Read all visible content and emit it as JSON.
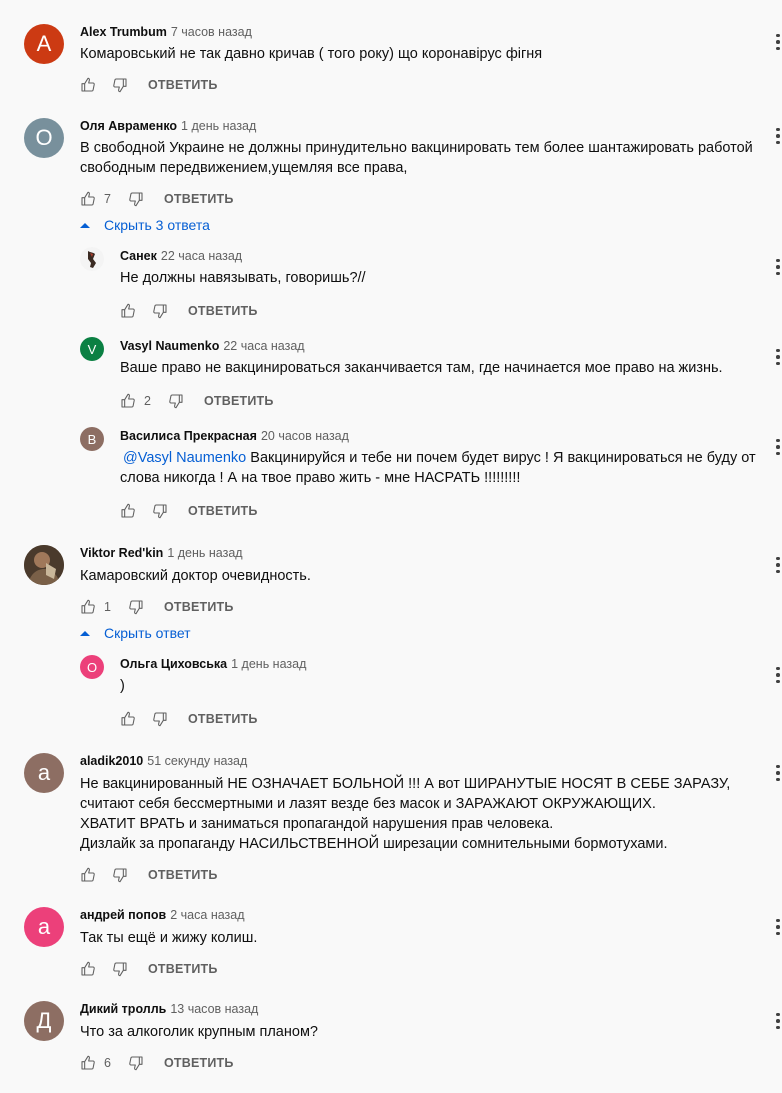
{
  "reply_label": "ОТВЕТИТЬ",
  "comments": [
    {
      "author": "Alex Trumbum",
      "time": "7 часов назад",
      "text": "Комаровський не так давно кричав ( того року) що коронавірус фігня",
      "likes": "",
      "avatar_letter": "A",
      "avatar_color": "#cc3a13"
    },
    {
      "author": "Оля Авраменко",
      "time": "1 день назад",
      "text": "В свободной Украине не должны принудительно вакцинировать тем более шантажировать работой свободным передвижением,ущемляя все права,",
      "likes": "7",
      "avatar_letter": "О",
      "avatar_color": "#78909c",
      "toggle": "Скрыть 3 ответа",
      "replies": [
        {
          "author": "Санек",
          "time": "22 часа назад",
          "text": "Не должны навязывать, говоришь?//",
          "likes": "",
          "avatar_letter": "",
          "avatar_color": "#ffffff"
        },
        {
          "author": "Vasyl Naumenko",
          "time": "22 часа назад",
          "text": "Ваше право не вакцинироваться заканчивается там, где начинается мое право на жизнь.",
          "likes": "2",
          "avatar_letter": "V",
          "avatar_color": "#0b8043"
        },
        {
          "author": "Василиса Прекрасная",
          "time": "20 часов назад",
          "mention": "@Vasyl Naumenko",
          "text": "Вакцинируйся и тебе ни почем будет вирус  ! Я вакцинироваться не буду от слова никогда ! А на твое право жить - мне НАСРАТЬ !!!!!!!!!",
          "likes": "",
          "avatar_letter": "В",
          "avatar_color": "#8d6e63"
        }
      ]
    },
    {
      "author": "Viktor Red'kin",
      "time": "1 день назад",
      "text": "Камаровский доктор очевидность.",
      "likes": "1",
      "avatar_letter": "",
      "avatar_color": "#5d4a3a",
      "toggle": "Скрыть ответ",
      "replies": [
        {
          "author": "Ольга Циховська",
          "time": "1 день назад",
          "text": ")",
          "likes": "",
          "avatar_letter": "О",
          "avatar_color": "#ec407a"
        }
      ]
    },
    {
      "author": "aladik2010",
      "time": "51 секунду назад",
      "text": "Не вакцинированный НЕ ОЗНАЧАЕТ БОЛЬНОЙ !!! А вот ШИРАНУТЫЕ НОСЯТ В СЕБЕ ЗАРАЗУ, считают себя бессмертными и лазят везде без масок и ЗАРАЖАЮТ ОКРУЖАЮЩИХ.\nХВАТИТ ВРАТЬ и заниматься пропагандой нарушения прав человека.\nДизлайк за пропаганду НАСИЛЬСТВЕННОЙ ширезации сомнительными бормотухами.",
      "likes": "",
      "avatar_letter": "a",
      "avatar_color": "#8d6e63"
    },
    {
      "author": "андрей попов",
      "time": "2 часа назад",
      "text": "Так ты ещё и жижу колиш.",
      "likes": "",
      "avatar_letter": "a",
      "avatar_color": "#ec407a"
    },
    {
      "author": "Дикий тролль",
      "time": "13 часов назад",
      "text": "Что за алкоголик крупным планом?",
      "likes": "6",
      "avatar_letter": "Д",
      "avatar_color": "#8d6e63"
    }
  ],
  "icons": {
    "like": "thumb-up-icon",
    "dislike": "thumb-down-icon",
    "menu": "more-vert-icon",
    "toggle": "caret-up-icon"
  }
}
